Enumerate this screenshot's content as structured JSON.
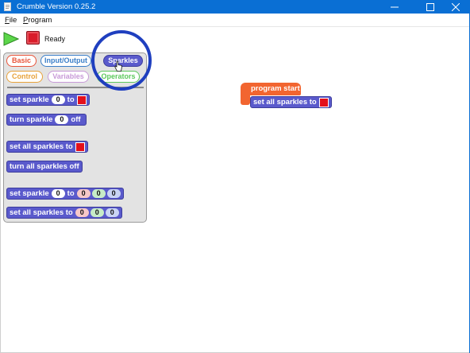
{
  "window": {
    "title": "Crumble Version 0.25.2",
    "minimize_icon": "minimize-icon",
    "maximize_icon": "maximize-icon",
    "close_icon": "close-icon"
  },
  "menu": {
    "file_first": "F",
    "file_rest": "ile",
    "program_first": "P",
    "program_rest": "rogram"
  },
  "toolbar": {
    "run_icon": "play-icon",
    "stop_icon": "stop-icon",
    "status": "Ready"
  },
  "categories": [
    {
      "label": "Basic",
      "color": "#e8543a"
    },
    {
      "label": "Input/Output",
      "color": "#3a7ec8"
    },
    {
      "label": "Sparkles",
      "color": "#5a5acc",
      "selected": true
    },
    {
      "label": "Control",
      "color": "#e8a23a"
    },
    {
      "label": "Variables",
      "color": "#c89ad8"
    },
    {
      "label": "Operators",
      "color": "#5cc85c"
    }
  ],
  "palette_blocks": {
    "set_sparkle": {
      "prefix": "set sparkle",
      "index": "0",
      "mid": "to",
      "color": "#e3101c"
    },
    "turn_sparkle": {
      "prefix": "turn sparkle",
      "index": "0",
      "suffix": "off"
    },
    "set_all_sparkles": {
      "prefix": "set all sparkles to",
      "color": "#e3101c"
    },
    "turn_all_off": {
      "label": "turn all sparkles off"
    },
    "set_sparkle_rgb": {
      "prefix": "set sparkle",
      "index": "0",
      "mid": "to",
      "r": "0",
      "g": "0",
      "b": "0"
    },
    "set_all_rgb": {
      "prefix": "set all sparkles to",
      "r": "0",
      "g": "0",
      "b": "0"
    }
  },
  "workspace": {
    "hat_label": "program start",
    "block_label": "set all sparkles to",
    "block_color": "#e3101c"
  },
  "annotation": {
    "ring_color": "#1f3fbf",
    "cursor_icon": "hand-pointer-icon"
  }
}
